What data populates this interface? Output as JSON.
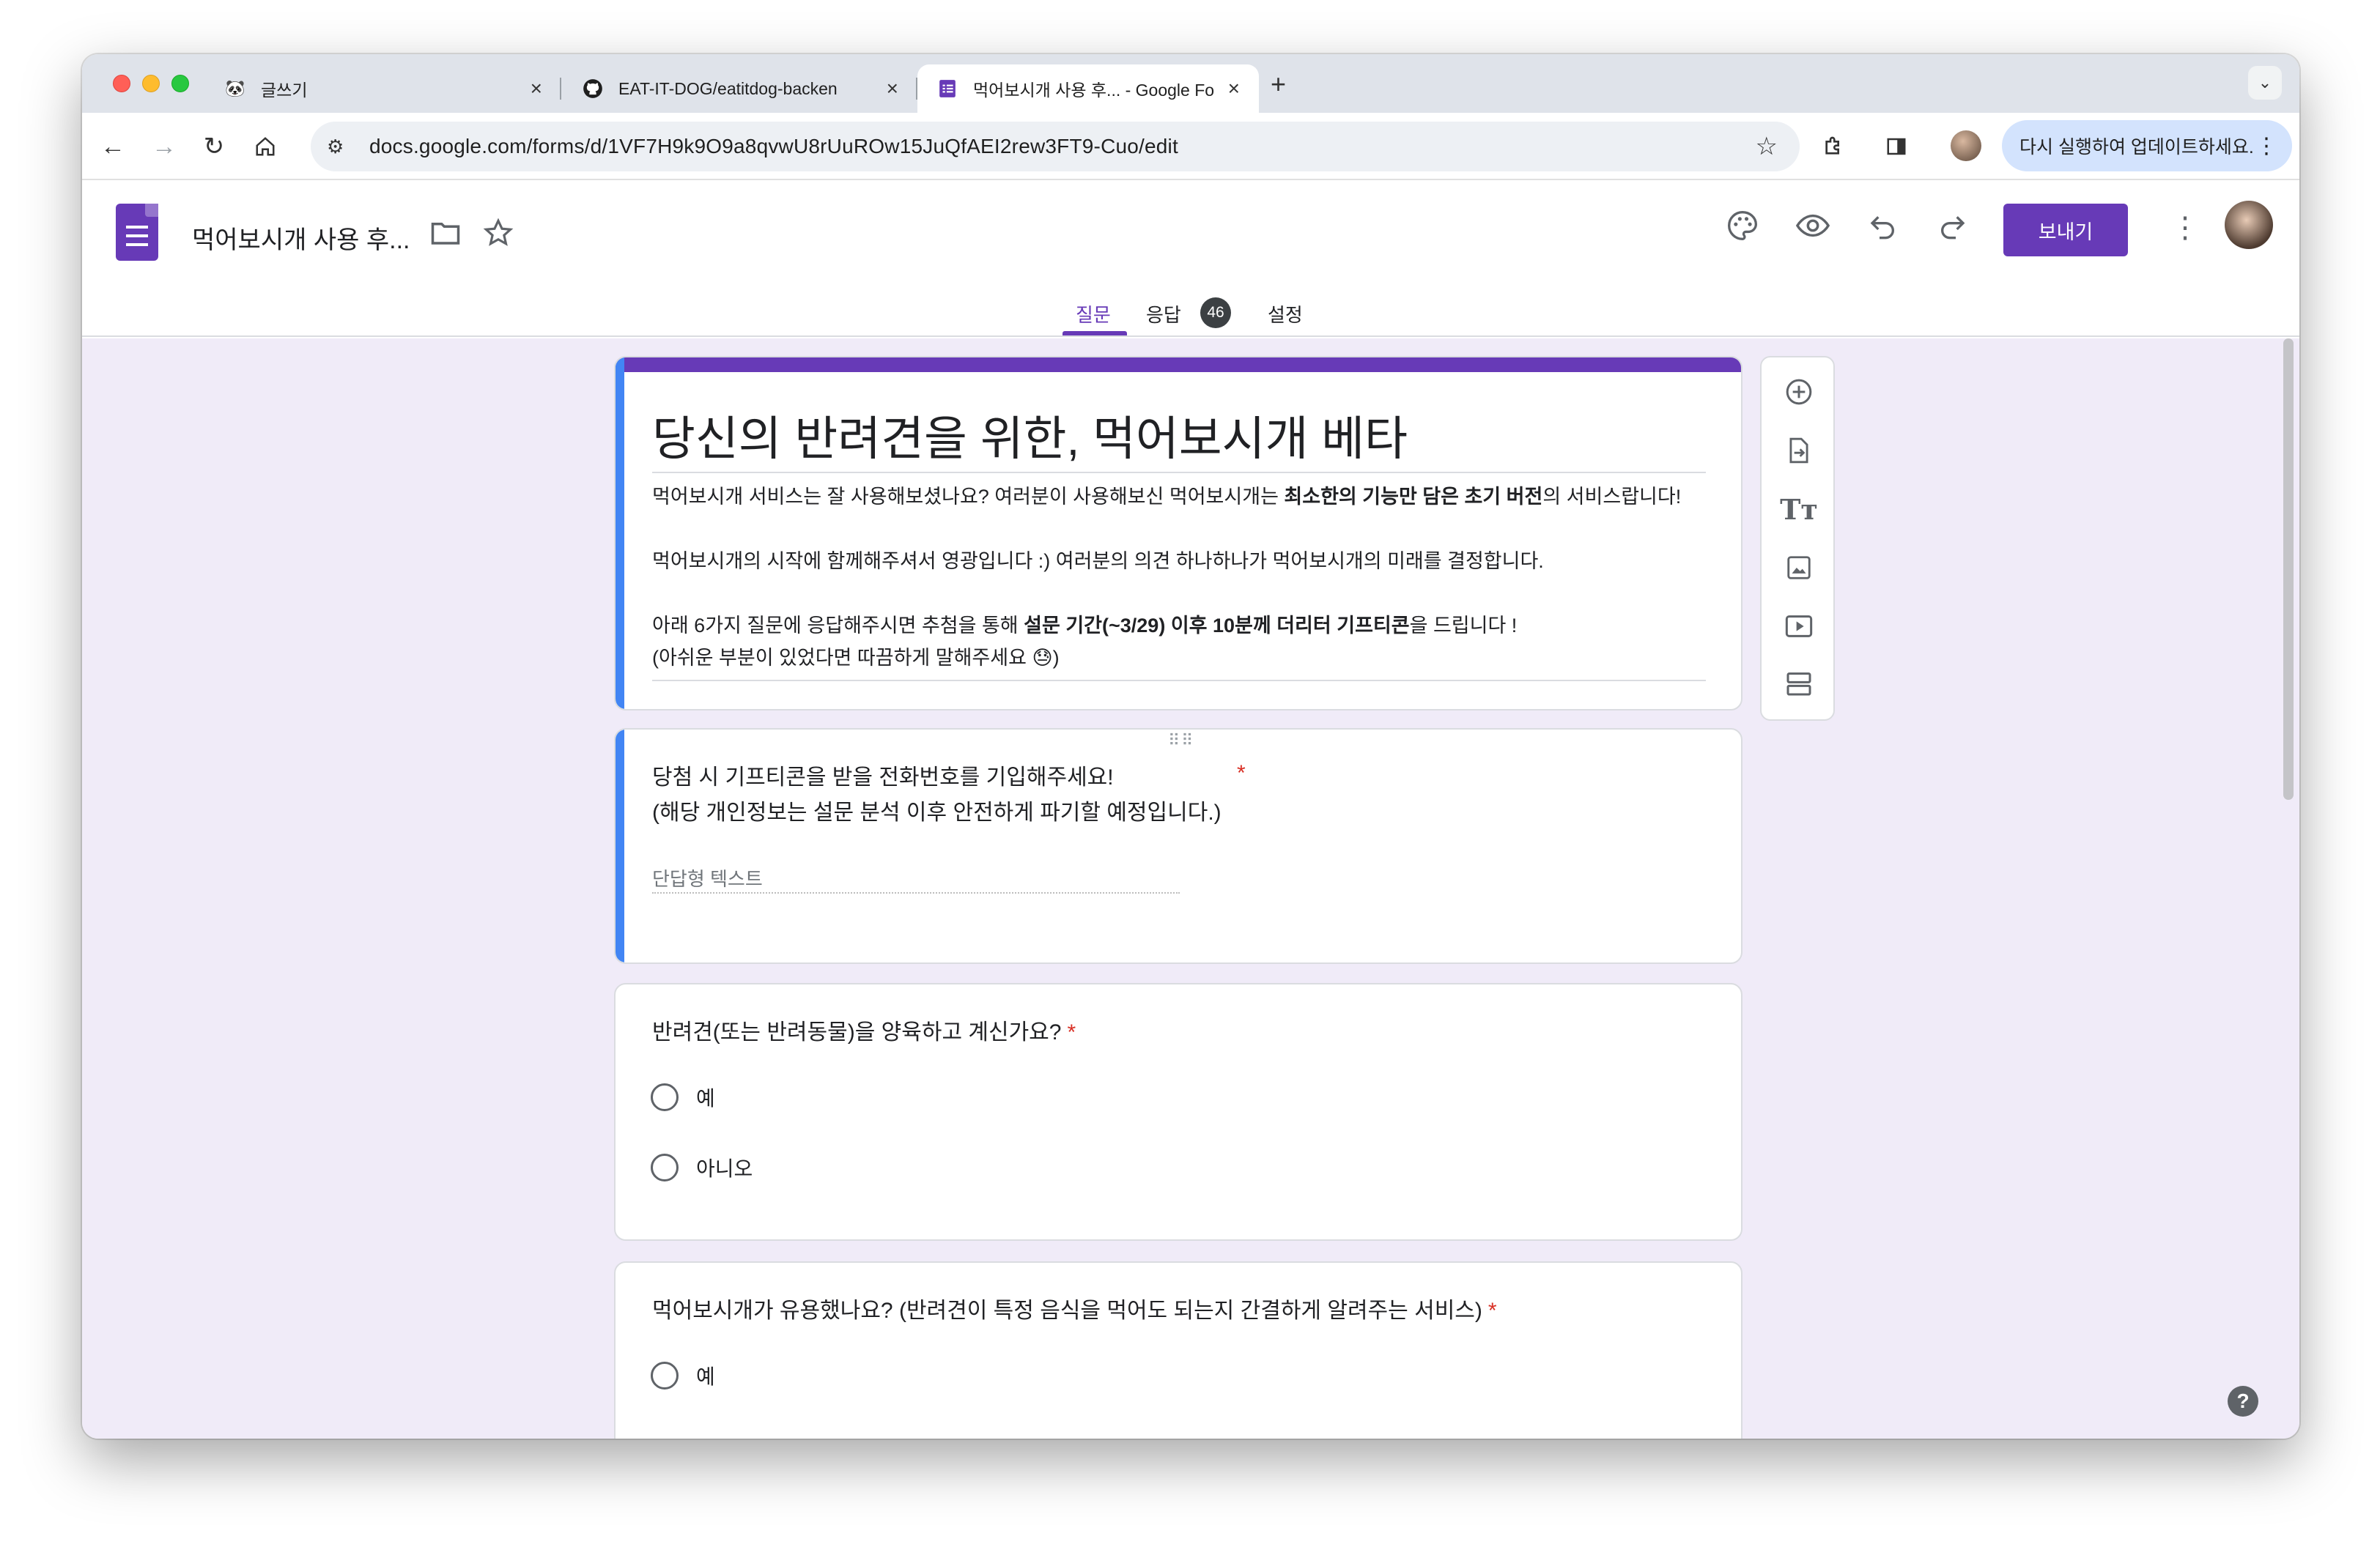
{
  "browser": {
    "tabs": [
      {
        "title": "글쓰기",
        "icon": "panda-icon"
      },
      {
        "title": "EAT-IT-DOG/eatitdog-backen",
        "icon": "github-icon"
      },
      {
        "title": "먹어보시개 사용 후... - Google Fo",
        "icon": "forms-icon"
      }
    ],
    "new_tab_label": "+",
    "url": "docs.google.com/forms/d/1VF7H9k9O9a8qvwU8rUuROw15JuQfAEI2rew3FT9-Cuo/edit",
    "update_button": "다시 실행하여 업데이트하세요."
  },
  "forms_header": {
    "doc_title": "먹어보시개 사용 후...",
    "send_label": "보내기",
    "tabs": [
      {
        "label": "질문",
        "active": true
      },
      {
        "label": "응답",
        "count": "46"
      },
      {
        "label": "설정"
      }
    ]
  },
  "form": {
    "title": "당신의 반려견을 위한, 먹어보시개 베타",
    "description": {
      "line1_pre": "먹어보시개 서비스는 잘 사용해보셨나요? 여러분이 사용해보신 먹어보시개는 ",
      "line1_bold": "최소한의 기능만 담은 초기 버전",
      "line1_post": "의 서비스랍니다!",
      "line2": "먹어보시개의 시작에 함께해주셔서 영광입니다 :) 여러분의 의견 하나하나가 먹어보시개의 미래를 결정합니다.",
      "line3_pre": "아래 6가지 질문에 응답해주시면 추첨을 통해 ",
      "line3_bold": "설문 기간(~3/29) 이후 10분께 더리터 기프티콘",
      "line3_post": "을 드립니다 !",
      "line4": "(아쉬운 부분이 있었다면 따끔하게 말해주세요 😓)"
    },
    "questions": [
      {
        "line1": "당첨 시 기프티콘을 받을 전화번호를 기입해주세요!",
        "line2": "(해당 개인정보는 설문 분석 이후 안전하게 파기할 예정입니다.)",
        "required_mark": "*",
        "placeholder": "단답형 텍스트"
      },
      {
        "text": "반려견(또는 반려동물)을 양육하고 계신가요?",
        "required_mark": "*",
        "options": [
          "예",
          "아니오"
        ]
      },
      {
        "text": "먹어보시개가 유용했나요? (반려견이 특정 음식을 먹어도 되는지 간결하게 알려주는 서비스)",
        "required_mark": "*",
        "options": [
          "예"
        ]
      }
    ]
  },
  "side_toolbar": [
    "add-question-icon",
    "import-questions-icon",
    "add-title-icon",
    "add-image-icon",
    "add-video-icon",
    "add-section-icon"
  ],
  "help_label": "?",
  "colors": {
    "accent": "#673ab7",
    "focus": "#4285f4",
    "background": "#f0ebf8"
  }
}
